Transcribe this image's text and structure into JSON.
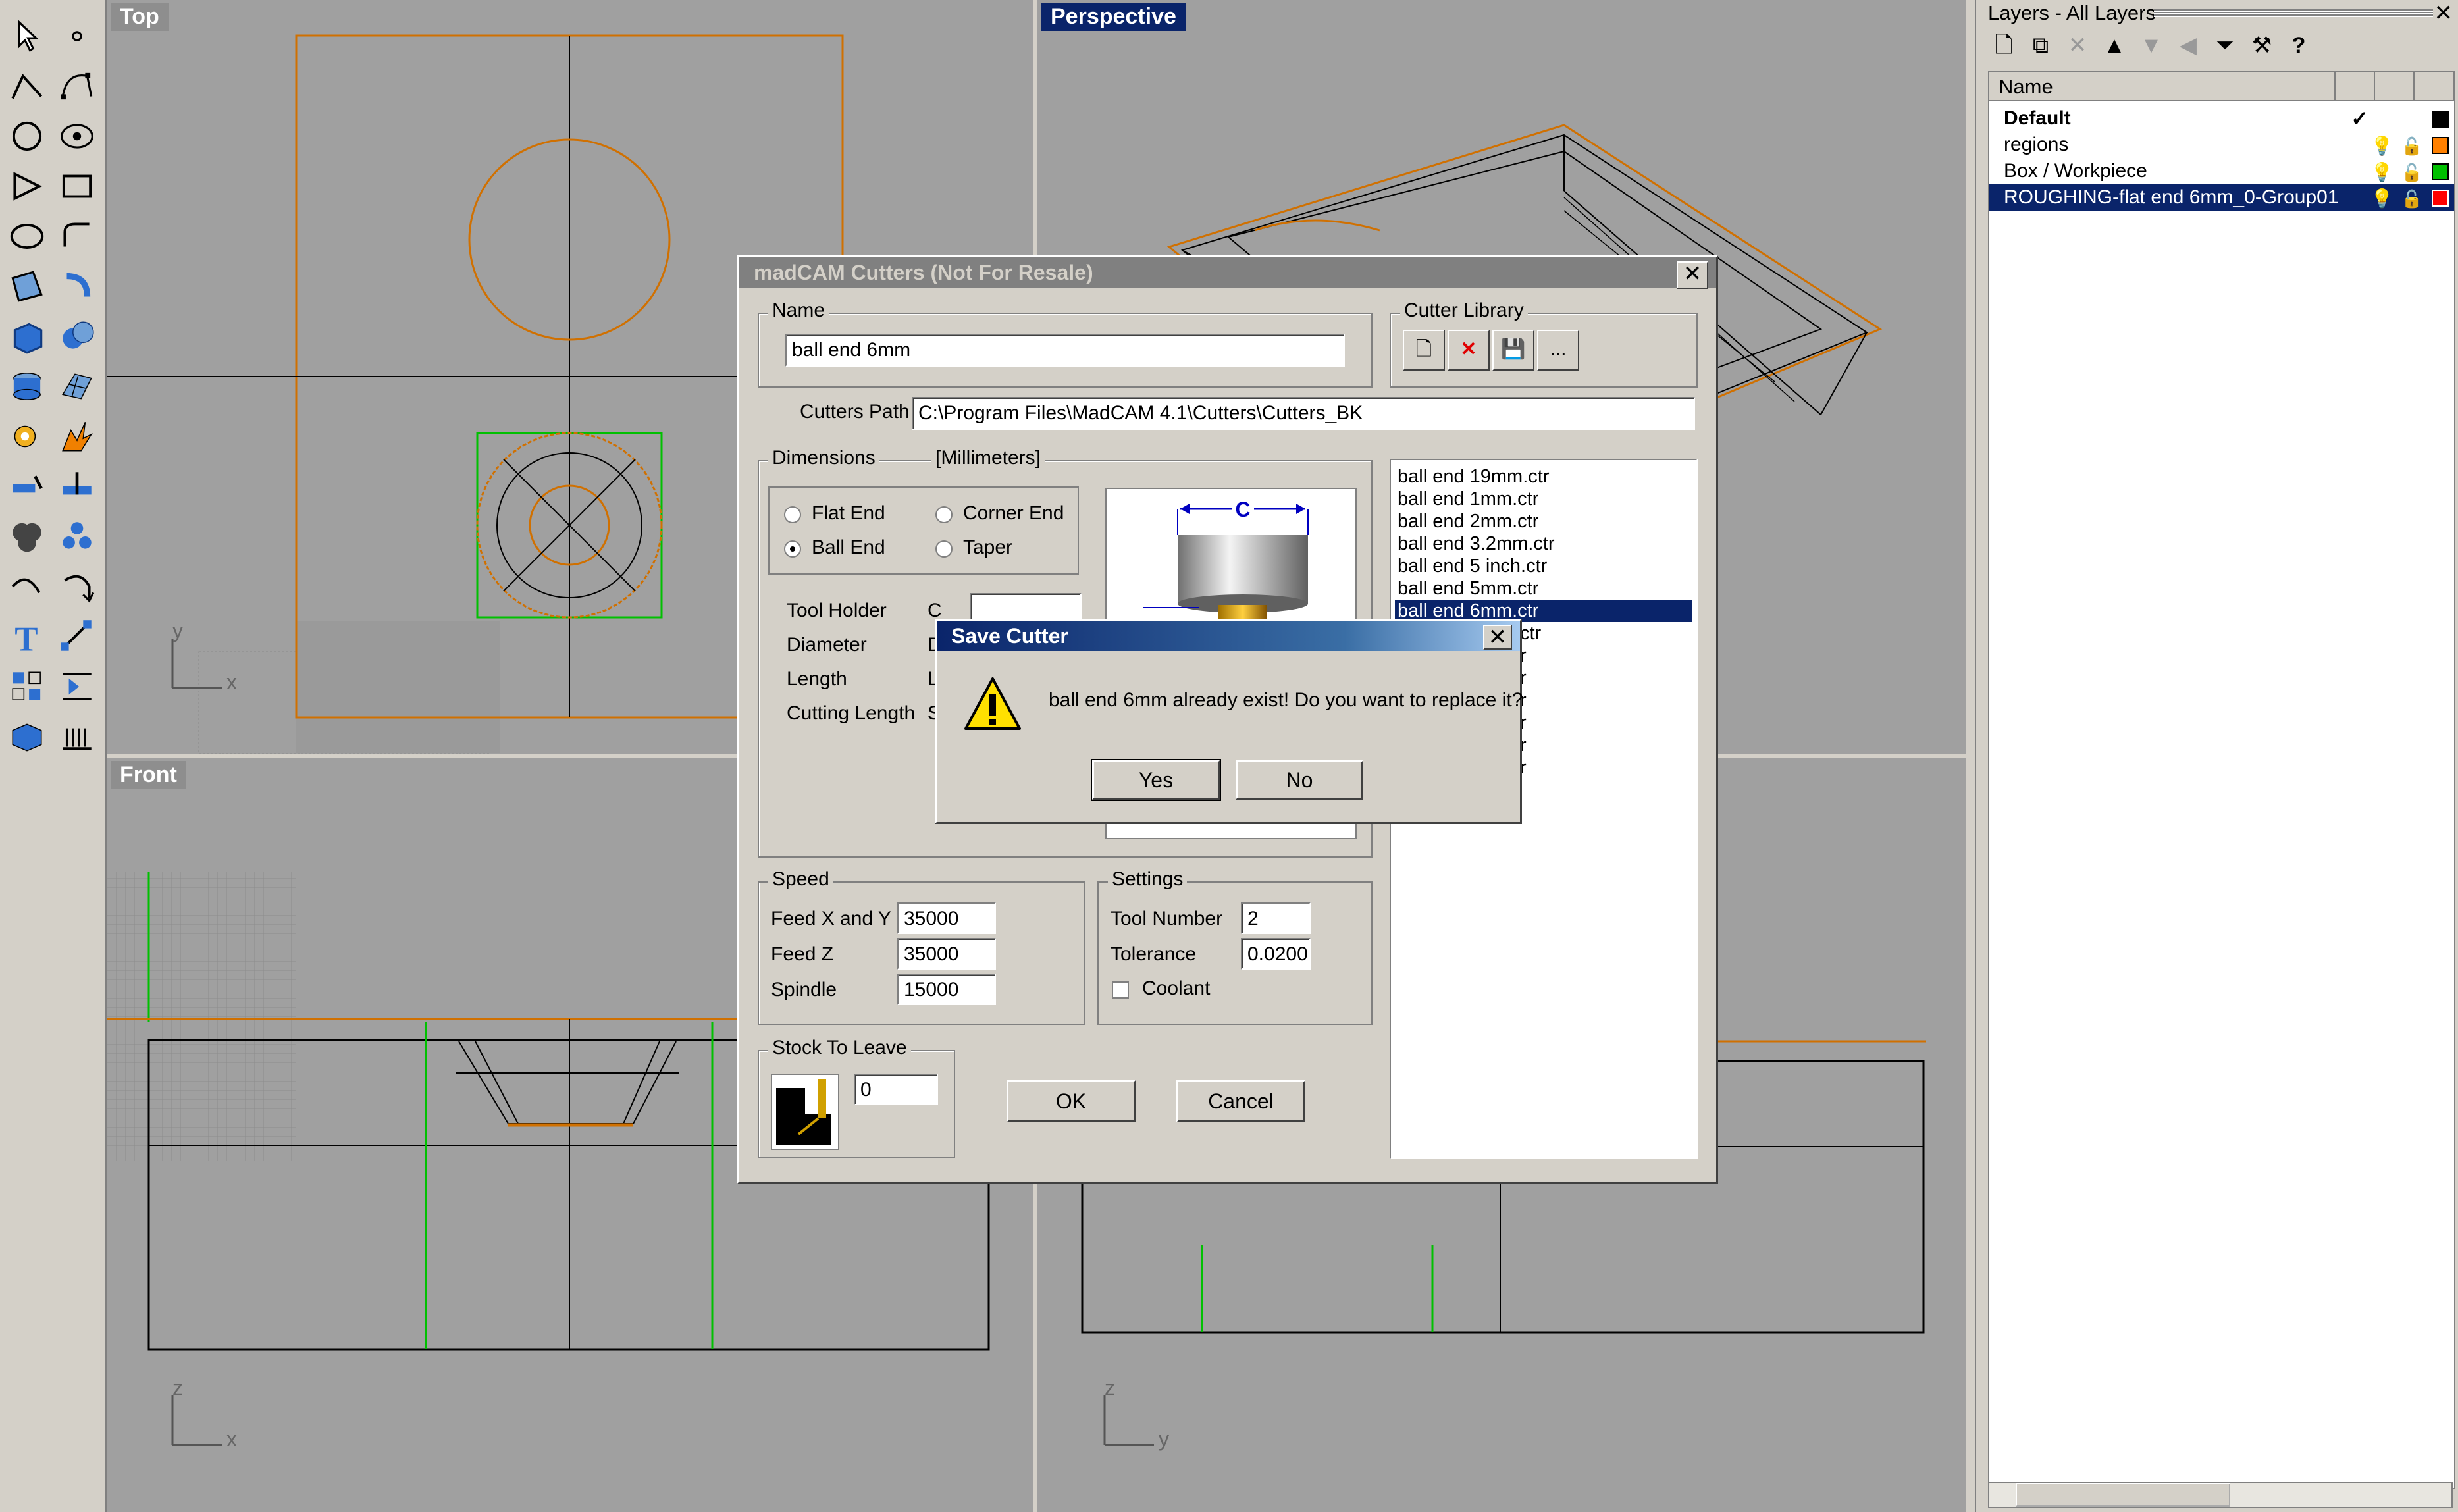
{
  "viewports": {
    "top": "Top",
    "perspective": "Perspective",
    "front": "Front",
    "right": ""
  },
  "axes": {
    "top_y": "y",
    "top_x": "x",
    "front_z": "z",
    "front_x": "x",
    "right_z": "z",
    "right_y": "y"
  },
  "layers": {
    "title": "Layers - All Layers",
    "column_name": "Name",
    "rows": [
      {
        "name": "Default",
        "color": "#000000",
        "current": "✓"
      },
      {
        "name": "regions",
        "color": "#ff8000"
      },
      {
        "name": "Box / Workpiece",
        "color": "#00c000"
      },
      {
        "name": "ROUGHING-flat end 6mm_0-Group01",
        "color": "#ff0000"
      }
    ]
  },
  "cutters_dialog": {
    "title": "madCAM  Cutters (Not For Resale)",
    "name_group": "Name",
    "name_value": "ball end 6mm",
    "library_group": "Cutter Library",
    "library_more": "...",
    "path_label": "Cutters Path",
    "path_value": "C:\\Program Files\\MadCAM 4.1\\Cutters\\Cutters_BK",
    "dimensions_group": "Dimensions",
    "units": "[Millimeters]",
    "radio_flat": "Flat End",
    "radio_corner": "Corner End",
    "radio_ball": "Ball End",
    "radio_taper": "Taper",
    "tool_holder": "Tool Holder",
    "diameter": "Diameter",
    "length": "Length",
    "cutting_length": "Cutting Length",
    "th_code": "C",
    "dia_code": "D",
    "len_code": "L",
    "cut_code": "S",
    "image_c": "C",
    "speed_group": "Speed",
    "feed_xy_label": "Feed X and Y",
    "feed_xy": "35000",
    "feed_z_label": "Feed Z",
    "feed_z": "35000",
    "spindle_label": "Spindle",
    "spindle": "15000",
    "settings_group": "Settings",
    "tool_number_label": "Tool Number",
    "tool_number": "2",
    "tolerance_label": "Tolerance",
    "tolerance": "0.0200",
    "coolant_label": "Coolant",
    "stock_group": "Stock To Leave",
    "stock_value": "0",
    "ok": "OK",
    "cancel": "Cancel",
    "files": [
      "ball end 19mm.ctr",
      "ball end 1mm.ctr",
      "ball end 2mm.ctr",
      "ball end 3.2mm.ctr",
      "ball end 5 inch.ctr",
      "ball end 5mm.ctr",
      "ball end 6mm.ctr",
      "ctr",
      "r",
      "r",
      "r",
      "r",
      "r",
      "r"
    ]
  },
  "save_dialog": {
    "title": "Save Cutter",
    "message": "ball end 6mm already exist! Do you want to replace it?",
    "yes": "Yes",
    "no": "No"
  }
}
